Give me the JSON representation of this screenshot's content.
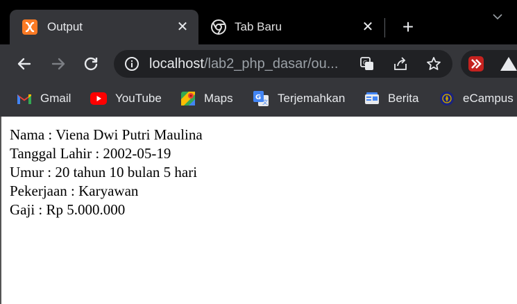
{
  "tabs": [
    {
      "title": "Output",
      "icon": "xampp-icon"
    },
    {
      "title": "Tab Baru",
      "icon": "chrome-icon"
    }
  ],
  "address": {
    "host": "localhost",
    "path": "/lab2_php_dasar/ou..."
  },
  "bookmarks": [
    {
      "label": "Gmail",
      "icon": "gmail-icon"
    },
    {
      "label": "YouTube",
      "icon": "youtube-icon"
    },
    {
      "label": "Maps",
      "icon": "maps-icon"
    },
    {
      "label": "Terjemahkan",
      "icon": "translate-icon"
    },
    {
      "label": "Berita",
      "icon": "news-icon"
    },
    {
      "label": "eCampus",
      "icon": "ecampus-icon"
    }
  ],
  "content": {
    "lines": [
      "Nama : Viena Dwi Putri Maulina",
      "Tanggal Lahir : 2002-05-19",
      "Umur : 20 tahun 10 bulan 5 hari",
      "Pekerjaan : Karyawan",
      "Gaji : Rp 5.000.000"
    ]
  },
  "colors": {
    "xampp": "#fb7a24",
    "youtube": "#ff0000",
    "accent": "#8ab4f8"
  }
}
